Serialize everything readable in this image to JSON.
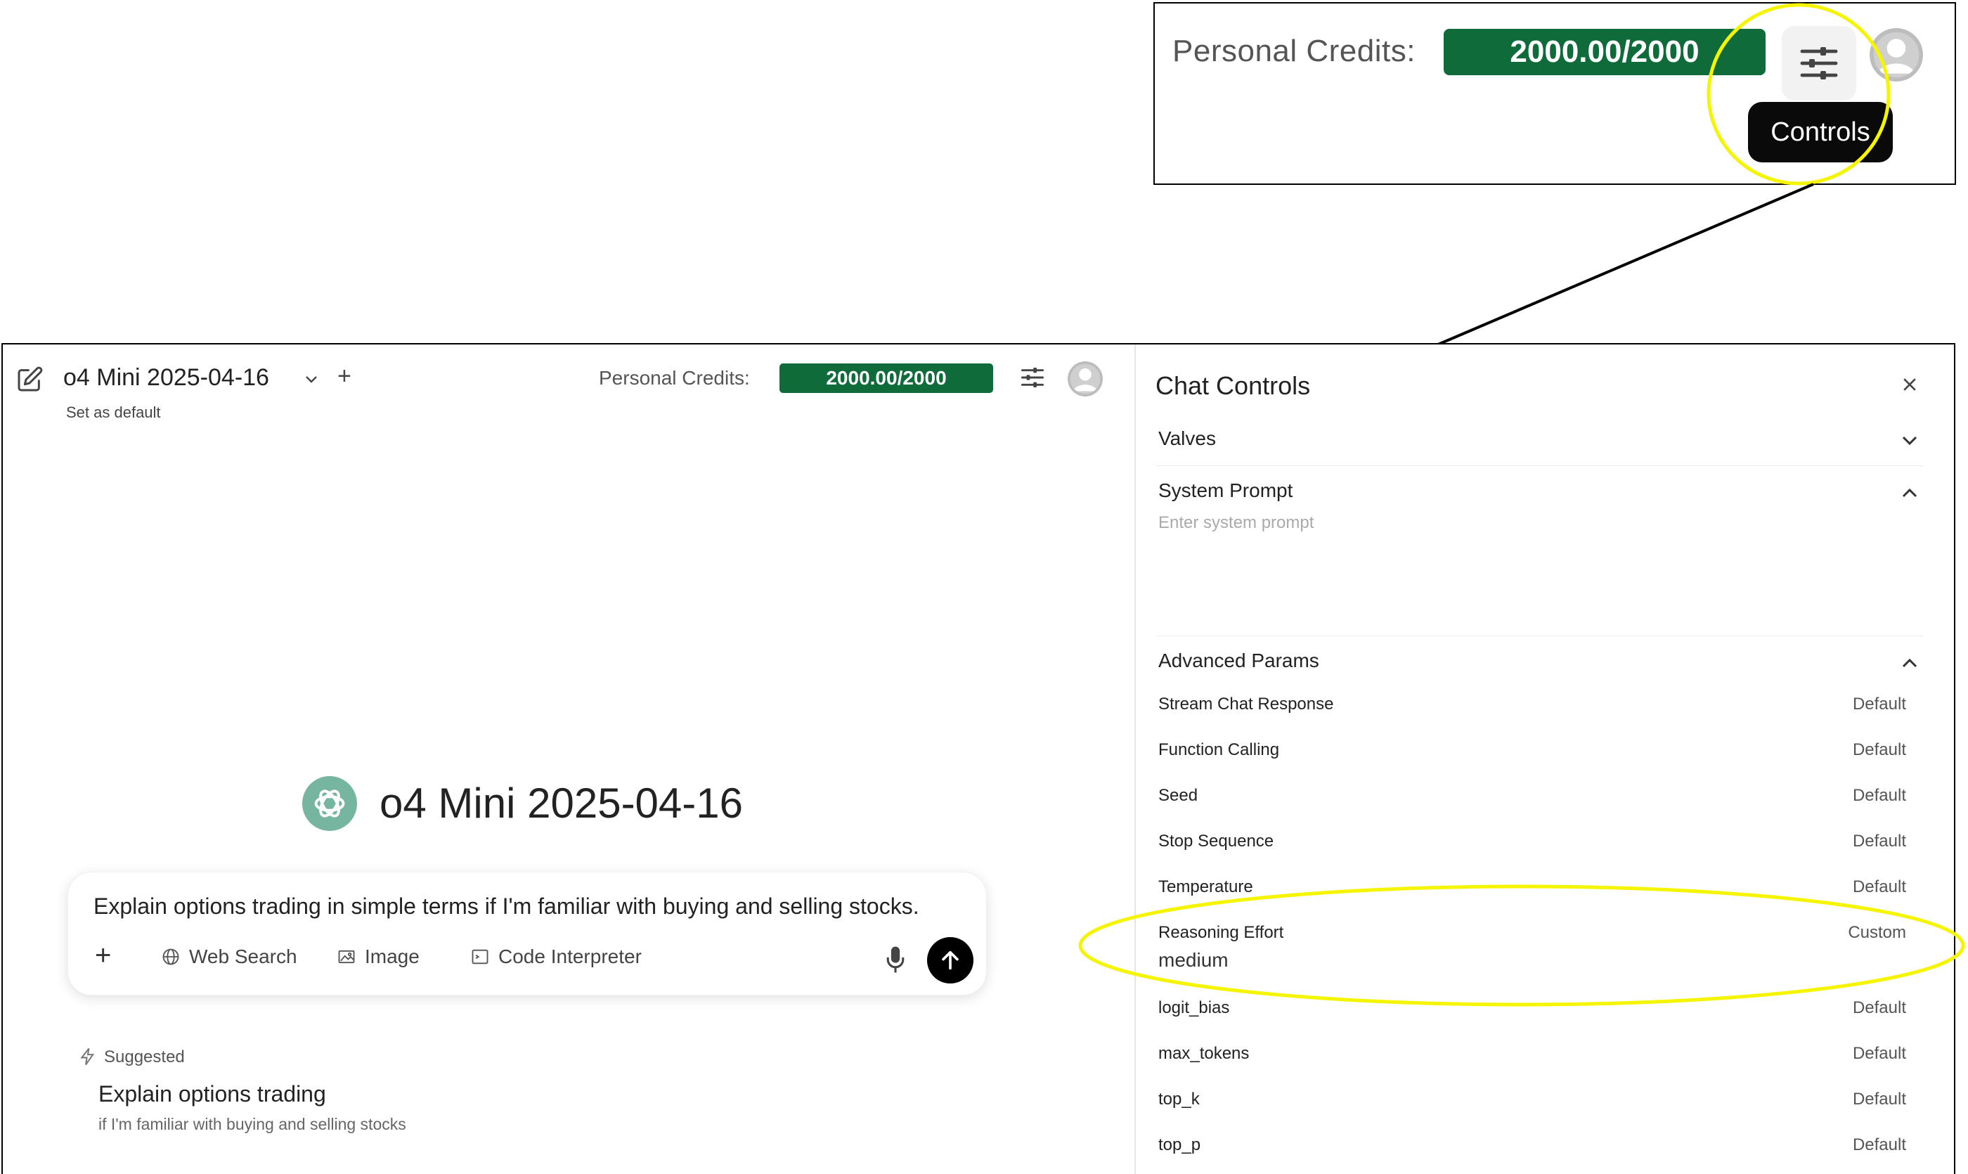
{
  "zoom_inset": {
    "credits_label": "Personal Credits:",
    "credits_value": "2000.00/2000",
    "controls_tooltip": "Controls",
    "controls_icon": "sliders-icon",
    "avatar_icon": "user-avatar-icon"
  },
  "colors": {
    "credits_badge": "#0f6b3a",
    "annotation_highlight": "#f5f500",
    "send_button": "#000000"
  },
  "header": {
    "model_name": "o4 Mini 2025-04-16",
    "set_default": "Set as default",
    "credits_label": "Personal Credits:",
    "credits_value": "2000.00/2000"
  },
  "welcome": {
    "model_heading": "o4 Mini 2025-04-16"
  },
  "composer": {
    "text": "Explain options trading in simple terms if I'm familiar with buying and selling stocks.",
    "tools": [
      "Web Search",
      "Image",
      "Code Interpreter"
    ]
  },
  "suggested": {
    "label": "Suggested",
    "title": "Explain options trading",
    "subtitle": "if I'm familiar with buying and selling stocks"
  },
  "chat_controls": {
    "title": "Chat Controls",
    "valves": "Valves",
    "system_prompt": "System Prompt",
    "system_prompt_placeholder": "Enter system prompt",
    "advanced_params": "Advanced Params",
    "params": [
      {
        "name": "Stream Chat Response",
        "value": "Default"
      },
      {
        "name": "Function Calling",
        "value": "Default"
      },
      {
        "name": "Seed",
        "value": "Default"
      },
      {
        "name": "Stop Sequence",
        "value": "Default"
      },
      {
        "name": "Temperature",
        "value": "Default"
      },
      {
        "name": "Reasoning Effort",
        "value": "Custom"
      },
      {
        "name": "logit_bias",
        "value": "Default"
      },
      {
        "name": "max_tokens",
        "value": "Default"
      },
      {
        "name": "top_k",
        "value": "Default"
      },
      {
        "name": "top_p",
        "value": "Default"
      }
    ],
    "reasoning_effort_value": "medium"
  }
}
